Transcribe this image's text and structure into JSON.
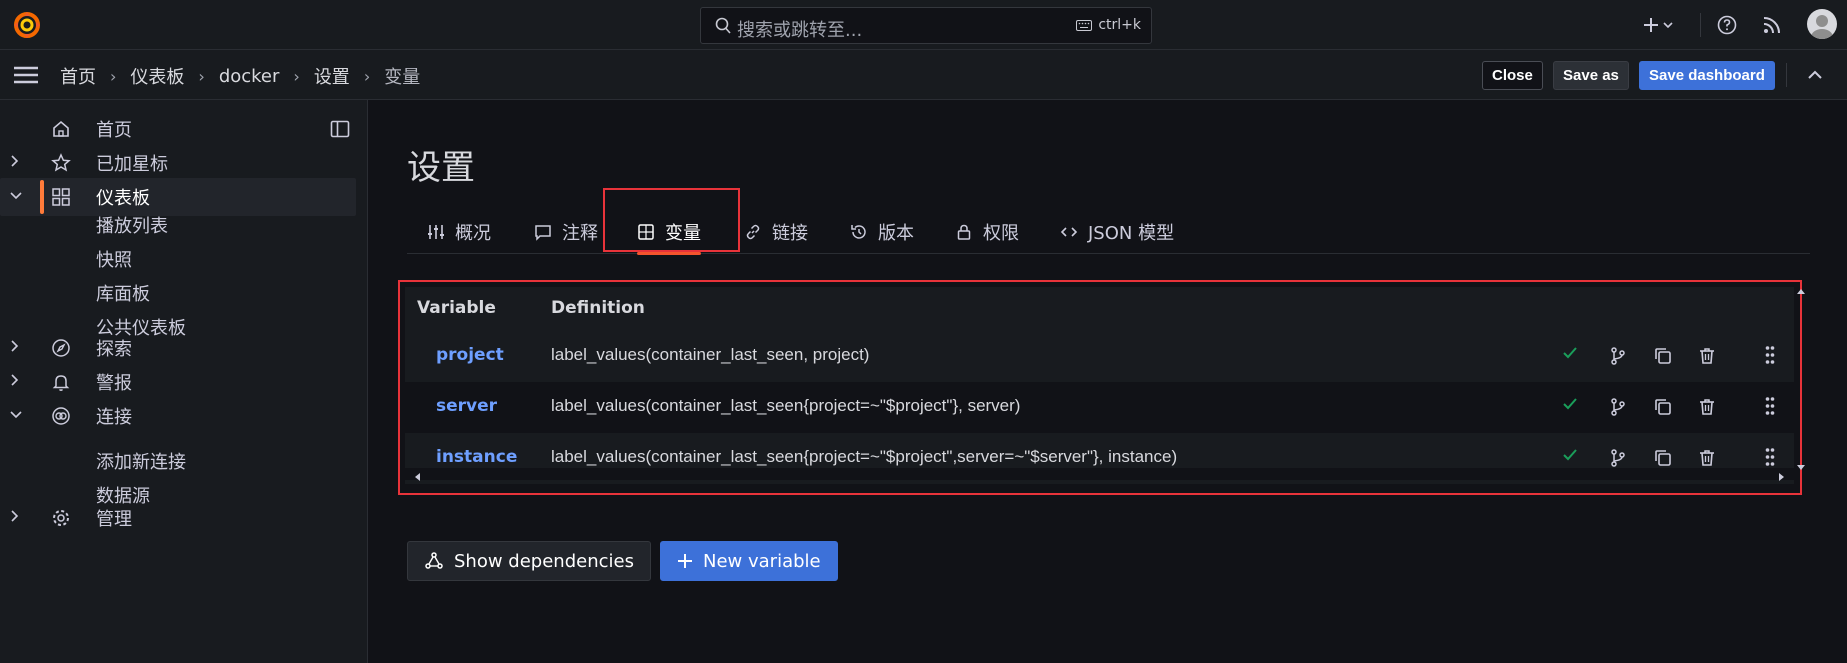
{
  "topbar": {
    "search_placeholder": "搜索或跳转至...",
    "shortcut": "ctrl+k"
  },
  "breadcrumb": [
    "首页",
    "仪表板",
    "docker",
    "设置",
    "变量"
  ],
  "header_buttons": {
    "close": "Close",
    "save_as": "Save as",
    "save_dashboard": "Save dashboard"
  },
  "sidebar": {
    "items": [
      {
        "label": "首页",
        "icon": "home-icon"
      },
      {
        "label": "已加星标",
        "icon": "star-icon"
      },
      {
        "label": "仪表板",
        "icon": "apps-icon"
      },
      {
        "label": "探索",
        "icon": "compass-icon"
      },
      {
        "label": "警报",
        "icon": "bell-icon"
      },
      {
        "label": "连接",
        "icon": "connections-icon"
      },
      {
        "label": "管理",
        "icon": "gear-icon"
      }
    ],
    "dashboard_sub": [
      "播放列表",
      "快照",
      "库面板",
      "公共仪表板"
    ],
    "connections_sub": [
      "添加新连接",
      "数据源"
    ]
  },
  "page": {
    "title": "设置",
    "tabs": [
      "概况",
      "注释",
      "变量",
      "链接",
      "版本",
      "权限",
      "JSON 模型"
    ],
    "active_tab": "变量"
  },
  "variables": {
    "headers": [
      "Variable",
      "Definition"
    ],
    "rows": [
      {
        "name": "project",
        "definition": "label_values(container_last_seen, project)"
      },
      {
        "name": "server",
        "definition": "label_values(container_last_seen{project=~\"$project\"}, server)"
      },
      {
        "name": "instance",
        "definition": "label_values(container_last_seen{project=~\"$project\",server=~\"$server\"}, instance)"
      }
    ]
  },
  "actions": {
    "show_dependencies": "Show dependencies",
    "new_variable": "New variable"
  },
  "colors": {
    "accent": "#3d71d9",
    "active_indicator": "#ff7b3a",
    "highlight_box": "#e8333a",
    "variable_name": "#6e9fff",
    "check": "#1a9e5a"
  }
}
